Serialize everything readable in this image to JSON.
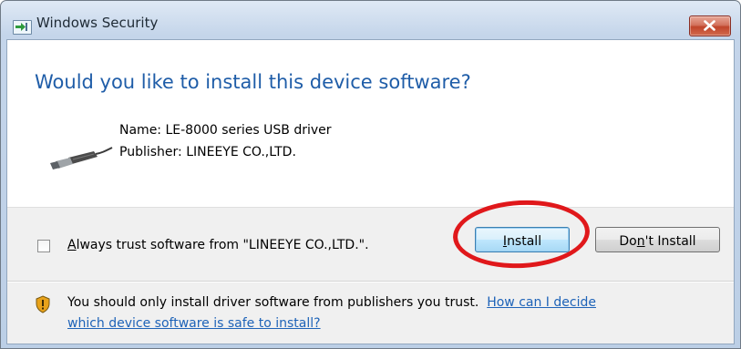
{
  "window": {
    "title": "Windows Security",
    "close_label": "×"
  },
  "main": {
    "heading": "Would you like to install this device software?",
    "device_icon": "usb-plug-icon",
    "name_line": "Name: LE-8000 series USB driver",
    "publisher_line": "Publisher: LINEEYE CO.,LTD."
  },
  "footer": {
    "trust_checkbox_checked": false,
    "trust_label_accesskey": "A",
    "trust_label_rest": "lways trust software from \"LINEEYE CO.,LTD.\".",
    "install_accesskey": "I",
    "install_rest": "nstall",
    "dont_install_pre": "Do",
    "dont_install_accesskey": "n",
    "dont_install_post": "'t Install",
    "warning_icon": "shield-warning-icon",
    "warning_text": "You should only install driver software from publishers you trust.",
    "help_link_part1": "How can I decide",
    "help_link_part2": "which device software is safe to install?"
  },
  "colors": {
    "heading": "#1f5da8",
    "link": "#1e63b8",
    "highlight_ring": "#e0181b"
  }
}
